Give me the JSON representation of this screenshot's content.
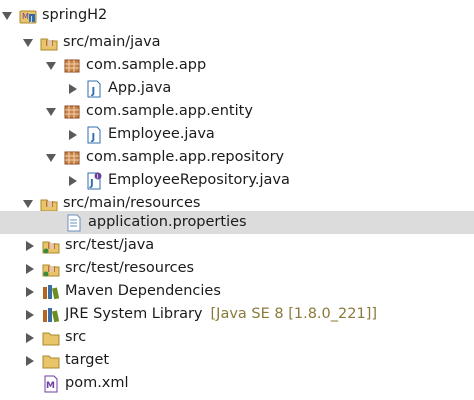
{
  "explorer": {
    "nodes": [
      {
        "label": "springH2",
        "icon": "maven-project-icon",
        "expanded": true
      },
      {
        "label": "src/main/java",
        "icon": "source-folder-icon",
        "expanded": true
      },
      {
        "label": "com.sample.app",
        "icon": "package-icon",
        "expanded": true
      },
      {
        "label": "App.java",
        "icon": "java-file-icon",
        "expanded": false
      },
      {
        "label": "com.sample.app.entity",
        "icon": "package-icon",
        "expanded": true
      },
      {
        "label": "Employee.java",
        "icon": "java-file-icon",
        "expanded": false
      },
      {
        "label": "com.sample.app.repository",
        "icon": "package-icon",
        "expanded": true
      },
      {
        "label": "EmployeeRepository.java",
        "icon": "java-interface-file-icon",
        "expanded": false
      },
      {
        "label": "src/main/resources",
        "icon": "source-folder-icon",
        "expanded": true
      },
      {
        "label": "application.properties",
        "icon": "properties-file-icon",
        "selected": true
      },
      {
        "label": "src/test/java",
        "icon": "source-folder-icon",
        "expanded": false
      },
      {
        "label": "src/test/resources",
        "icon": "source-folder-icon",
        "expanded": false
      },
      {
        "label": "Maven Dependencies",
        "icon": "library-icon",
        "expanded": false
      },
      {
        "label": "JRE System Library",
        "decoration": "[Java SE 8 [1.8.0_221]]",
        "icon": "library-icon",
        "expanded": false
      },
      {
        "label": "src",
        "icon": "folder-icon",
        "expanded": false
      },
      {
        "label": "target",
        "icon": "folder-icon",
        "expanded": false
      },
      {
        "label": "pom.xml",
        "icon": "maven-pom-icon"
      }
    ]
  },
  "colors": {
    "selection": "#dcdcdc",
    "decoration": "#8a7a3a",
    "folder": "#e9c46a",
    "package": "#b5651d",
    "java": "#2f6db0"
  }
}
